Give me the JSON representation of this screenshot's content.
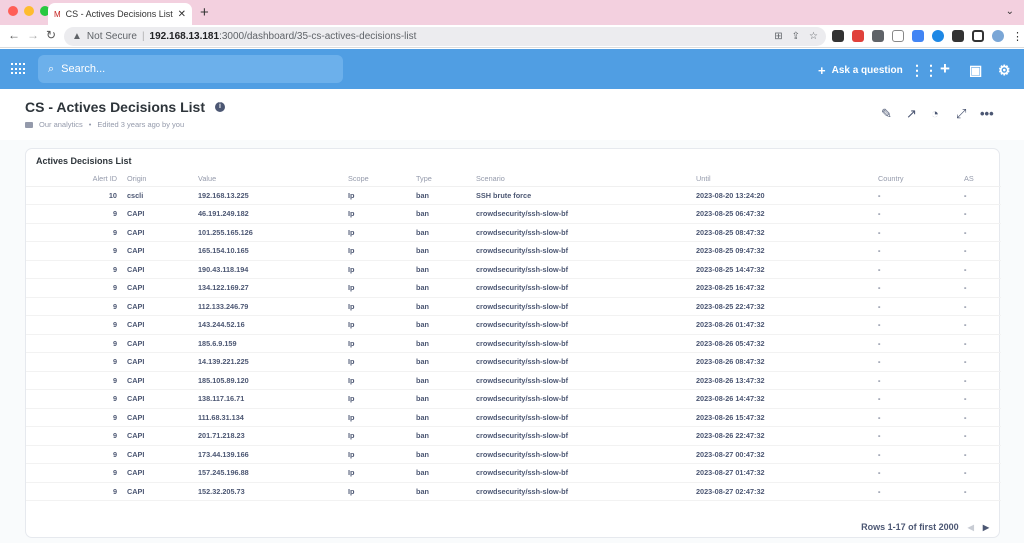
{
  "browser": {
    "tab_title": "CS - Actives Decisions List · D",
    "not_secure": "Not Secure",
    "url_host": "192.168.13.181",
    "url_path": ":3000/dashboard/35-cs-actives-decisions-list"
  },
  "header": {
    "search_placeholder": "Search...",
    "ask_question": "Ask a question"
  },
  "dashboard": {
    "title": "CS - Actives Decisions List",
    "collection": "Our analytics",
    "edited": "Edited 3 years ago by you"
  },
  "card": {
    "title": "Actives Decisions List",
    "columns": [
      "Alert ID",
      "Origin",
      "Value",
      "Scope",
      "Type",
      "Scenario",
      "Until",
      "Country",
      "AS"
    ],
    "rows": [
      [
        "10",
        "cscli",
        "192.168.13.225",
        "Ip",
        "ban",
        "SSH brute force",
        "2023-08-20 13:24:20",
        "-",
        "-"
      ],
      [
        "9",
        "CAPI",
        "46.191.249.182",
        "Ip",
        "ban",
        "crowdsecurity/ssh-slow-bf",
        "2023-08-25 06:47:32",
        "-",
        "-"
      ],
      [
        "9",
        "CAPI",
        "101.255.165.126",
        "Ip",
        "ban",
        "crowdsecurity/ssh-slow-bf",
        "2023-08-25 08:47:32",
        "-",
        "-"
      ],
      [
        "9",
        "CAPI",
        "165.154.10.165",
        "Ip",
        "ban",
        "crowdsecurity/ssh-slow-bf",
        "2023-08-25 09:47:32",
        "-",
        "-"
      ],
      [
        "9",
        "CAPI",
        "190.43.118.194",
        "Ip",
        "ban",
        "crowdsecurity/ssh-slow-bf",
        "2023-08-25 14:47:32",
        "-",
        "-"
      ],
      [
        "9",
        "CAPI",
        "134.122.169.27",
        "Ip",
        "ban",
        "crowdsecurity/ssh-slow-bf",
        "2023-08-25 16:47:32",
        "-",
        "-"
      ],
      [
        "9",
        "CAPI",
        "112.133.246.79",
        "Ip",
        "ban",
        "crowdsecurity/ssh-slow-bf",
        "2023-08-25 22:47:32",
        "-",
        "-"
      ],
      [
        "9",
        "CAPI",
        "143.244.52.16",
        "Ip",
        "ban",
        "crowdsecurity/ssh-slow-bf",
        "2023-08-26 01:47:32",
        "-",
        "-"
      ],
      [
        "9",
        "CAPI",
        "185.6.9.159",
        "Ip",
        "ban",
        "crowdsecurity/ssh-slow-bf",
        "2023-08-26 05:47:32",
        "-",
        "-"
      ],
      [
        "9",
        "CAPI",
        "14.139.221.225",
        "Ip",
        "ban",
        "crowdsecurity/ssh-slow-bf",
        "2023-08-26 08:47:32",
        "-",
        "-"
      ],
      [
        "9",
        "CAPI",
        "185.105.89.120",
        "Ip",
        "ban",
        "crowdsecurity/ssh-slow-bf",
        "2023-08-26 13:47:32",
        "-",
        "-"
      ],
      [
        "9",
        "CAPI",
        "138.117.16.71",
        "Ip",
        "ban",
        "crowdsecurity/ssh-slow-bf",
        "2023-08-26 14:47:32",
        "-",
        "-"
      ],
      [
        "9",
        "CAPI",
        "111.68.31.134",
        "Ip",
        "ban",
        "crowdsecurity/ssh-slow-bf",
        "2023-08-26 15:47:32",
        "-",
        "-"
      ],
      [
        "9",
        "CAPI",
        "201.71.218.23",
        "Ip",
        "ban",
        "crowdsecurity/ssh-slow-bf",
        "2023-08-26 22:47:32",
        "-",
        "-"
      ],
      [
        "9",
        "CAPI",
        "173.44.139.166",
        "Ip",
        "ban",
        "crowdsecurity/ssh-slow-bf",
        "2023-08-27 00:47:32",
        "-",
        "-"
      ],
      [
        "9",
        "CAPI",
        "157.245.196.88",
        "Ip",
        "ban",
        "crowdsecurity/ssh-slow-bf",
        "2023-08-27 01:47:32",
        "-",
        "-"
      ],
      [
        "9",
        "CAPI",
        "152.32.205.73",
        "Ip",
        "ban",
        "crowdsecurity/ssh-slow-bf",
        "2023-08-27 02:47:32",
        "-",
        "-"
      ]
    ],
    "footer": "Rows 1-17 of first 2000"
  },
  "colors": {
    "header_blue": "#509ee3",
    "tabstrip": "#f3d0df"
  }
}
